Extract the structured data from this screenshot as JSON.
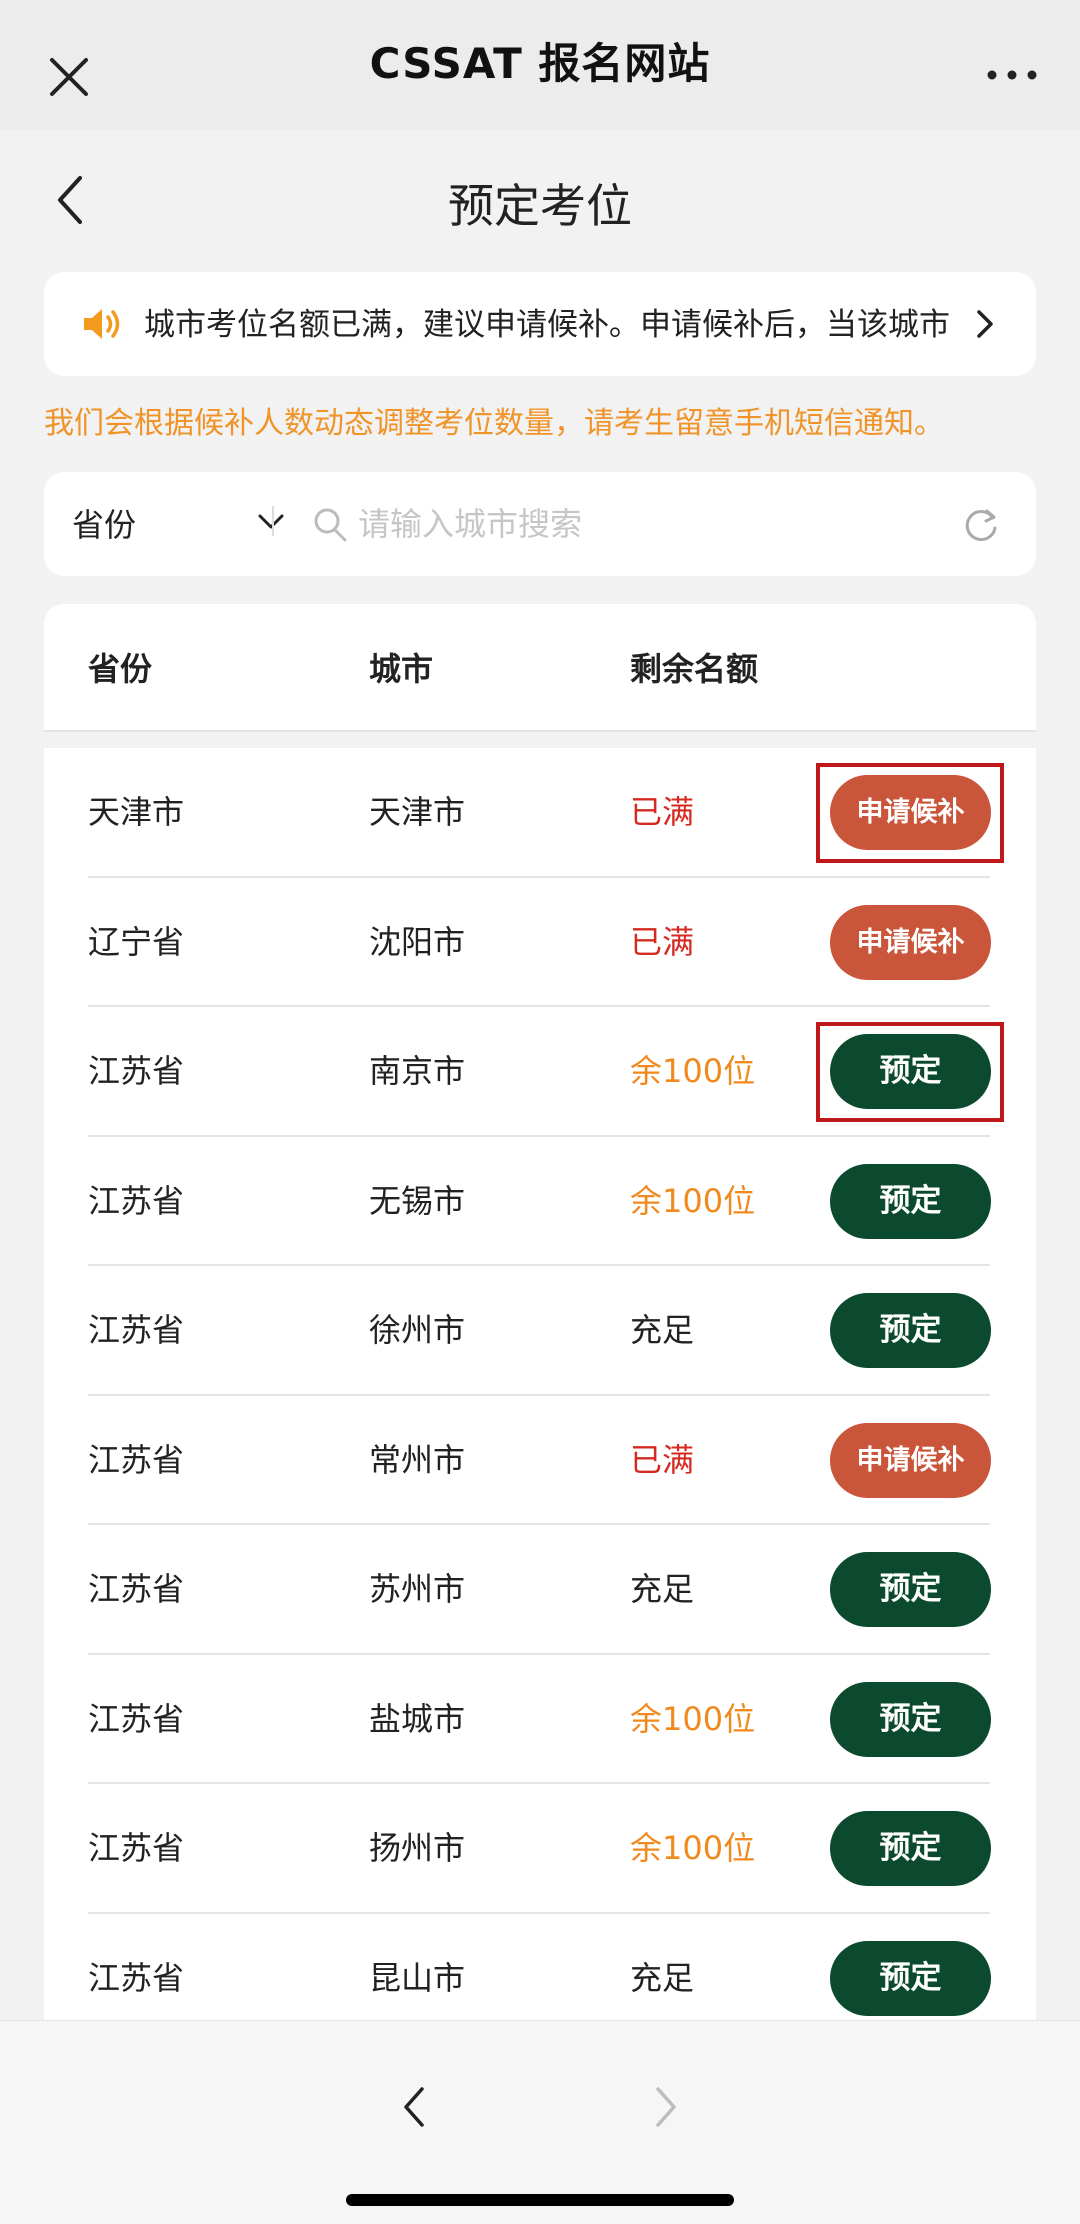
{
  "app": {
    "title": "CSSAT 报名网站",
    "close_icon": "close-icon",
    "more_icon": "more-dots-icon"
  },
  "page": {
    "title": "预定考位",
    "back_icon": "back-chevron-icon"
  },
  "notice": {
    "icon": "speaker-icon",
    "text": "城市考位名额已满，建议申请候补。申请候补后，当该城市",
    "arrow_icon": "chevron-right-icon"
  },
  "tip": "我们会根据候补人数动态调整考位数量，请考生留意手机短信通知。",
  "filter": {
    "province_label": "省份",
    "search_placeholder": "请输入城市搜索",
    "refresh_icon": "refresh-icon"
  },
  "table": {
    "headers": [
      "省份",
      "城市",
      "剩余名额"
    ],
    "rows": [
      {
        "province": "天津市",
        "city": "天津市",
        "remaining": "已满",
        "status": "full",
        "action": "申请候补",
        "highlighted": true
      },
      {
        "province": "辽宁省",
        "city": "沈阳市",
        "remaining": "已满",
        "status": "full",
        "action": "申请候补",
        "highlighted": false
      },
      {
        "province": "江苏省",
        "city": "南京市",
        "remaining": "余100位",
        "status": "few",
        "action": "预定",
        "highlighted": true
      },
      {
        "province": "江苏省",
        "city": "无锡市",
        "remaining": "余100位",
        "status": "few",
        "action": "预定",
        "highlighted": false
      },
      {
        "province": "江苏省",
        "city": "徐州市",
        "remaining": "充足",
        "status": "ok",
        "action": "预定",
        "highlighted": false
      },
      {
        "province": "江苏省",
        "city": "常州市",
        "remaining": "已满",
        "status": "full",
        "action": "申请候补",
        "highlighted": false
      },
      {
        "province": "江苏省",
        "city": "苏州市",
        "remaining": "充足",
        "status": "ok",
        "action": "预定",
        "highlighted": false
      },
      {
        "province": "江苏省",
        "city": "盐城市",
        "remaining": "余100位",
        "status": "few",
        "action": "预定",
        "highlighted": false
      },
      {
        "province": "江苏省",
        "city": "扬州市",
        "remaining": "余100位",
        "status": "few",
        "action": "预定",
        "highlighted": false
      },
      {
        "province": "江苏省",
        "city": "昆山市",
        "remaining": "充足",
        "status": "ok",
        "action": "预定",
        "highlighted": false
      }
    ]
  },
  "colors": {
    "full": "#d42a22",
    "few": "#f08a1e",
    "waitlist_button": "#c9553a",
    "book_button": "#0b4a2e",
    "tip_text": "#f0942a",
    "highlight_border": "#c01818"
  },
  "browser_nav": {
    "back_icon": "browser-back-icon",
    "forward_icon": "browser-forward-icon"
  }
}
